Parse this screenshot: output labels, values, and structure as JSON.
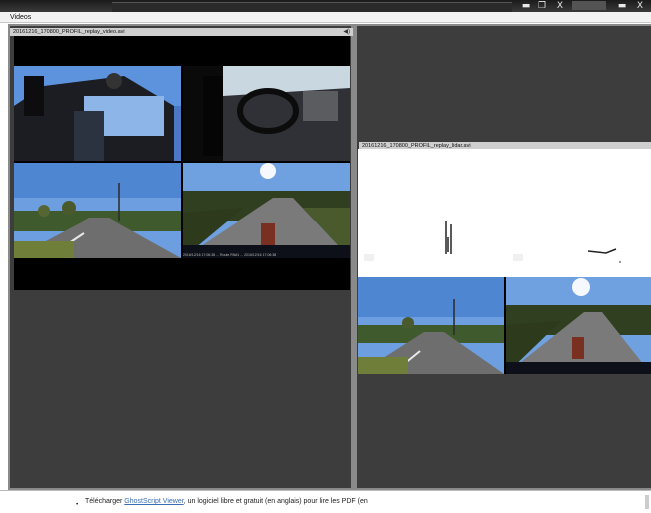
{
  "window": {
    "title": "Videos",
    "buttons": [
      "▬",
      "❐",
      "X"
    ],
    "extra_buttons": [
      "▬",
      "X"
    ]
  },
  "left_video": {
    "title": "20161216_170800_PROFIL_replay_video.avi",
    "speaker_icon": "speaker-icon",
    "overlay_text": "2016/12/16 17:06:38 ... Route RN#1 ... 2016/12/16 17:06:38"
  },
  "right_lidar": {
    "title": "20161216_170800_PROFIL_replay_lidar.avi"
  },
  "footer": {
    "bullet": "•",
    "prefix": "Télécharger ",
    "link": "GhostScript Viewer",
    "suffix": ", un logiciel libre et gratuit (en anglais) pour lire les PDF (en"
  },
  "colors": {
    "pane": "#3d3d3d",
    "sky": "#6c9ee0",
    "road": "#6e6e6e",
    "link": "#3a6db5"
  }
}
